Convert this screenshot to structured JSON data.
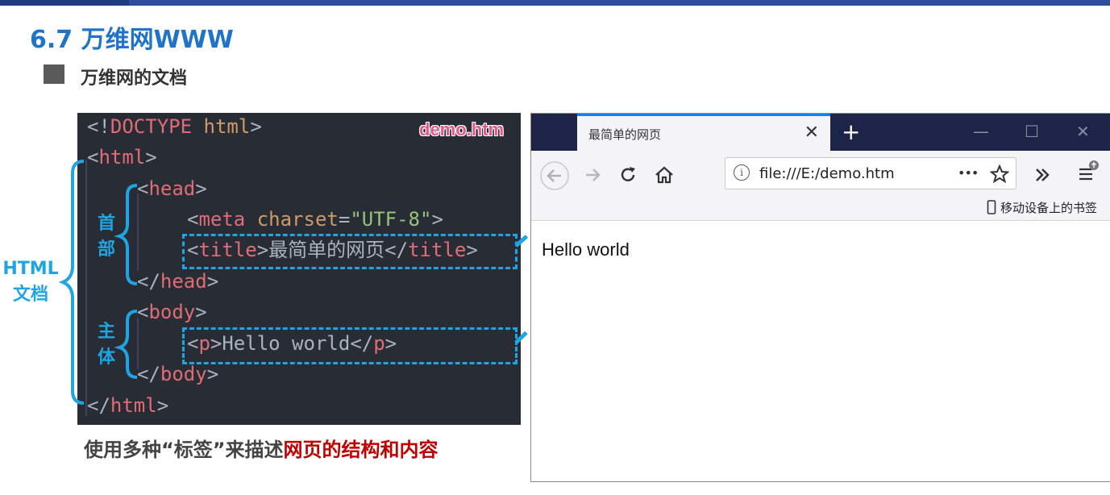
{
  "slide": {
    "title": "6.7 万维网WWW",
    "subtitle": "万维网的文档",
    "caption_normal": "使用多种“标签”来描述",
    "caption_red": "网页的结构和内容"
  },
  "code": {
    "file_label": "demo.htm",
    "line1": "<!DOCTYPE html>",
    "line_doctype_keyword": "DOCTYPE",
    "line_html_open": "html",
    "line_head_open": "head",
    "meta_tag": "meta",
    "meta_attr": "charset",
    "meta_value": "\"UTF-8\"",
    "title_tag": "title",
    "title_text": "最简单的网页",
    "head_close": "head",
    "body_open": "body",
    "p_tag": "p",
    "p_text": "Hello world",
    "body_close": "body",
    "html_close": "html"
  },
  "labels": {
    "html_doc": "HTML\n文档",
    "html_doc_1": "HTML",
    "html_doc_2": "文档",
    "head_1": "首",
    "head_2": "部",
    "body_1": "主",
    "body_2": "体"
  },
  "browser": {
    "tab_title": "最简单的网页",
    "tab_close": "✕",
    "new_tab": "+",
    "minimize": "—",
    "maximize": "☐",
    "close": "✕",
    "url": "file:///E:/demo.htm",
    "more": "•••",
    "bookmark_bar": "移动设备上的书签",
    "page_text": "Hello world"
  },
  "colors": {
    "accent_blue": "#1fa5e3",
    "title_blue": "#1f73c8",
    "caption_red": "#c00000",
    "code_bg": "#282c34"
  },
  "icons": {
    "back": "back-arrow-icon",
    "forward": "forward-arrow-icon",
    "reload": "reload-icon",
    "home": "home-icon",
    "info": "info-icon",
    "star": "star-icon",
    "overflow": "chevron-double-right-icon",
    "menu": "hamburger-menu-icon",
    "phone": "mobile-device-icon"
  }
}
